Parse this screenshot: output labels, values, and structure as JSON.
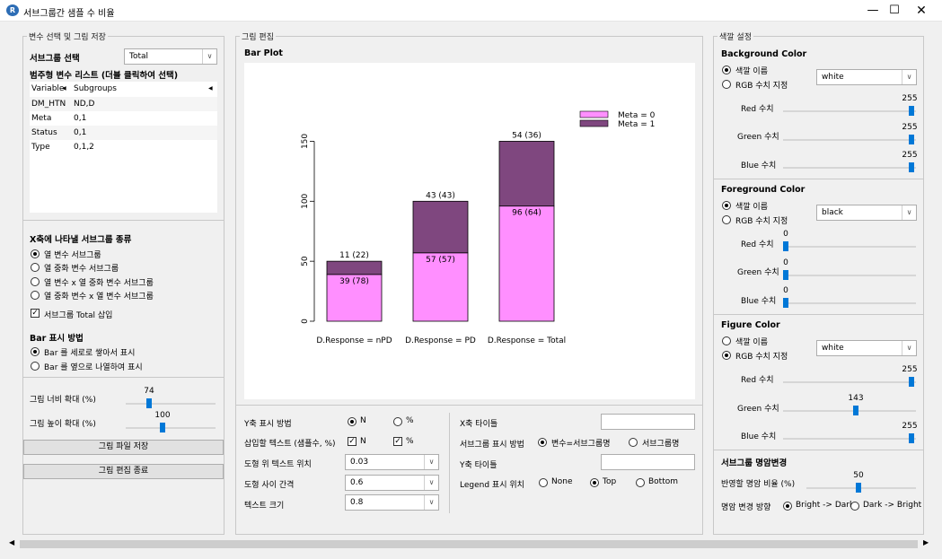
{
  "window": {
    "title": "서브그룹간 샘플 수 비율",
    "app_icon": "R"
  },
  "left": {
    "group_title": "변수 선택 및 그림 저장",
    "subgroup_label": "서브그룹 선택",
    "subgroup_value": "Total",
    "list_label": "범주형 변수 리스트 (더블 클릭하여 선택)",
    "table_headers": [
      "Variable",
      "Subgroups"
    ],
    "table_rows": [
      [
        "DM_HTN",
        "ND,D"
      ],
      [
        "Meta",
        "0,1"
      ],
      [
        "Status",
        "0,1"
      ],
      [
        "Type",
        "0,1,2"
      ]
    ],
    "xaxis_title": "X축에 나타낼 서브그룹 종류",
    "xaxis_options": [
      "열 변수 서브그룹",
      "열 중화 변수 서브그룹",
      "열 변수 x 열 중화 변수 서브그룹",
      "열 중화 변수 x 열 변수 서브그룹"
    ],
    "total_check": "서브그룹 Total 삽입",
    "bar_title": "Bar 표시 방법",
    "bar_options": [
      "Bar 를 세로로 쌓아서 표시",
      "Bar 를 옆으로 나열하여 표시"
    ],
    "width_label": "그림 너비 확대 (%)",
    "width_value": "74",
    "height_label": "그림 높이 확대 (%)",
    "height_value": "100",
    "save_button": "그림 파일 저장",
    "end_button": "그림 편집 종료"
  },
  "center": {
    "group_title": "그림 편집",
    "plot_title": "Bar Plot",
    "y_method_label": "Y축 표시 방법",
    "y_method_n": "N",
    "y_method_pct": "%",
    "insert_text_label": "삽입할 텍스트 (샘플수, %)",
    "insert_n": "N",
    "insert_pct": "%",
    "text_pos_label": "도형 위 텍스트 위치",
    "text_pos_value": "0.03",
    "gap_label": "도형 사이 간격",
    "gap_value": "0.6",
    "text_size_label": "텍스트 크기",
    "text_size_value": "0.8",
    "x_title_label": "X축 타이틀",
    "subgroup_display_label": "서브그룹 표시 방법",
    "subgroup_display_opt1": "변수=서브그룹명",
    "subgroup_display_opt2": "서브그룹명",
    "y_title_label": "Y축 타이틀",
    "legend_pos_label": "Legend 표시 위치",
    "legend_opts": [
      "None",
      "Top",
      "Bottom"
    ]
  },
  "right": {
    "group_title": "색깔 설정",
    "bg_title": "Background Color",
    "fg_title": "Foreground Color",
    "fig_title": "Figure Color",
    "color_name_opt": "색깔 이름",
    "rgb_opt": "RGB 수치 지정",
    "bg_color": "white",
    "fg_color": "black",
    "fig_color": "white",
    "red_label": "Red 수치",
    "green_label": "Green 수치",
    "blue_label": "Blue 수치",
    "bg_rgb": [
      "255",
      "255",
      "255"
    ],
    "fg_rgb": [
      "0",
      "0",
      "0"
    ],
    "fig_rgb": [
      "255",
      "143",
      "255"
    ],
    "bright_title": "서브그룹 명암변경",
    "bright_ratio_label": "반영할 명암 비율 (%)",
    "bright_ratio_value": "50",
    "bright_dir_label": "명암 변경 방향",
    "bright_dir_opt1": "Bright -> Dark",
    "bright_dir_opt2": "Dark -> Bright"
  },
  "colors": {
    "meta0": "#ff8fff",
    "meta1": "#7f477f",
    "accent": "#0078d7"
  },
  "chart_data": {
    "type": "bar",
    "stacked": true,
    "title": "",
    "categories": [
      "D.Response = nPD",
      "D.Response = PD",
      "D.Response = Total"
    ],
    "series": [
      {
        "name": "Meta = 0",
        "values": [
          39,
          57,
          96
        ],
        "labels": [
          "39 (78)",
          "57 (57)",
          "96 (64)"
        ]
      },
      {
        "name": "Meta = 1",
        "values": [
          11,
          43,
          54
        ],
        "labels": [
          "11 (22)",
          "43 (43)",
          "54 (36)"
        ]
      }
    ],
    "yticks": [
      "0",
      "50",
      "100",
      "150"
    ],
    "ylim": [
      0,
      160
    ],
    "legend_position": "top-right",
    "grid": false
  }
}
